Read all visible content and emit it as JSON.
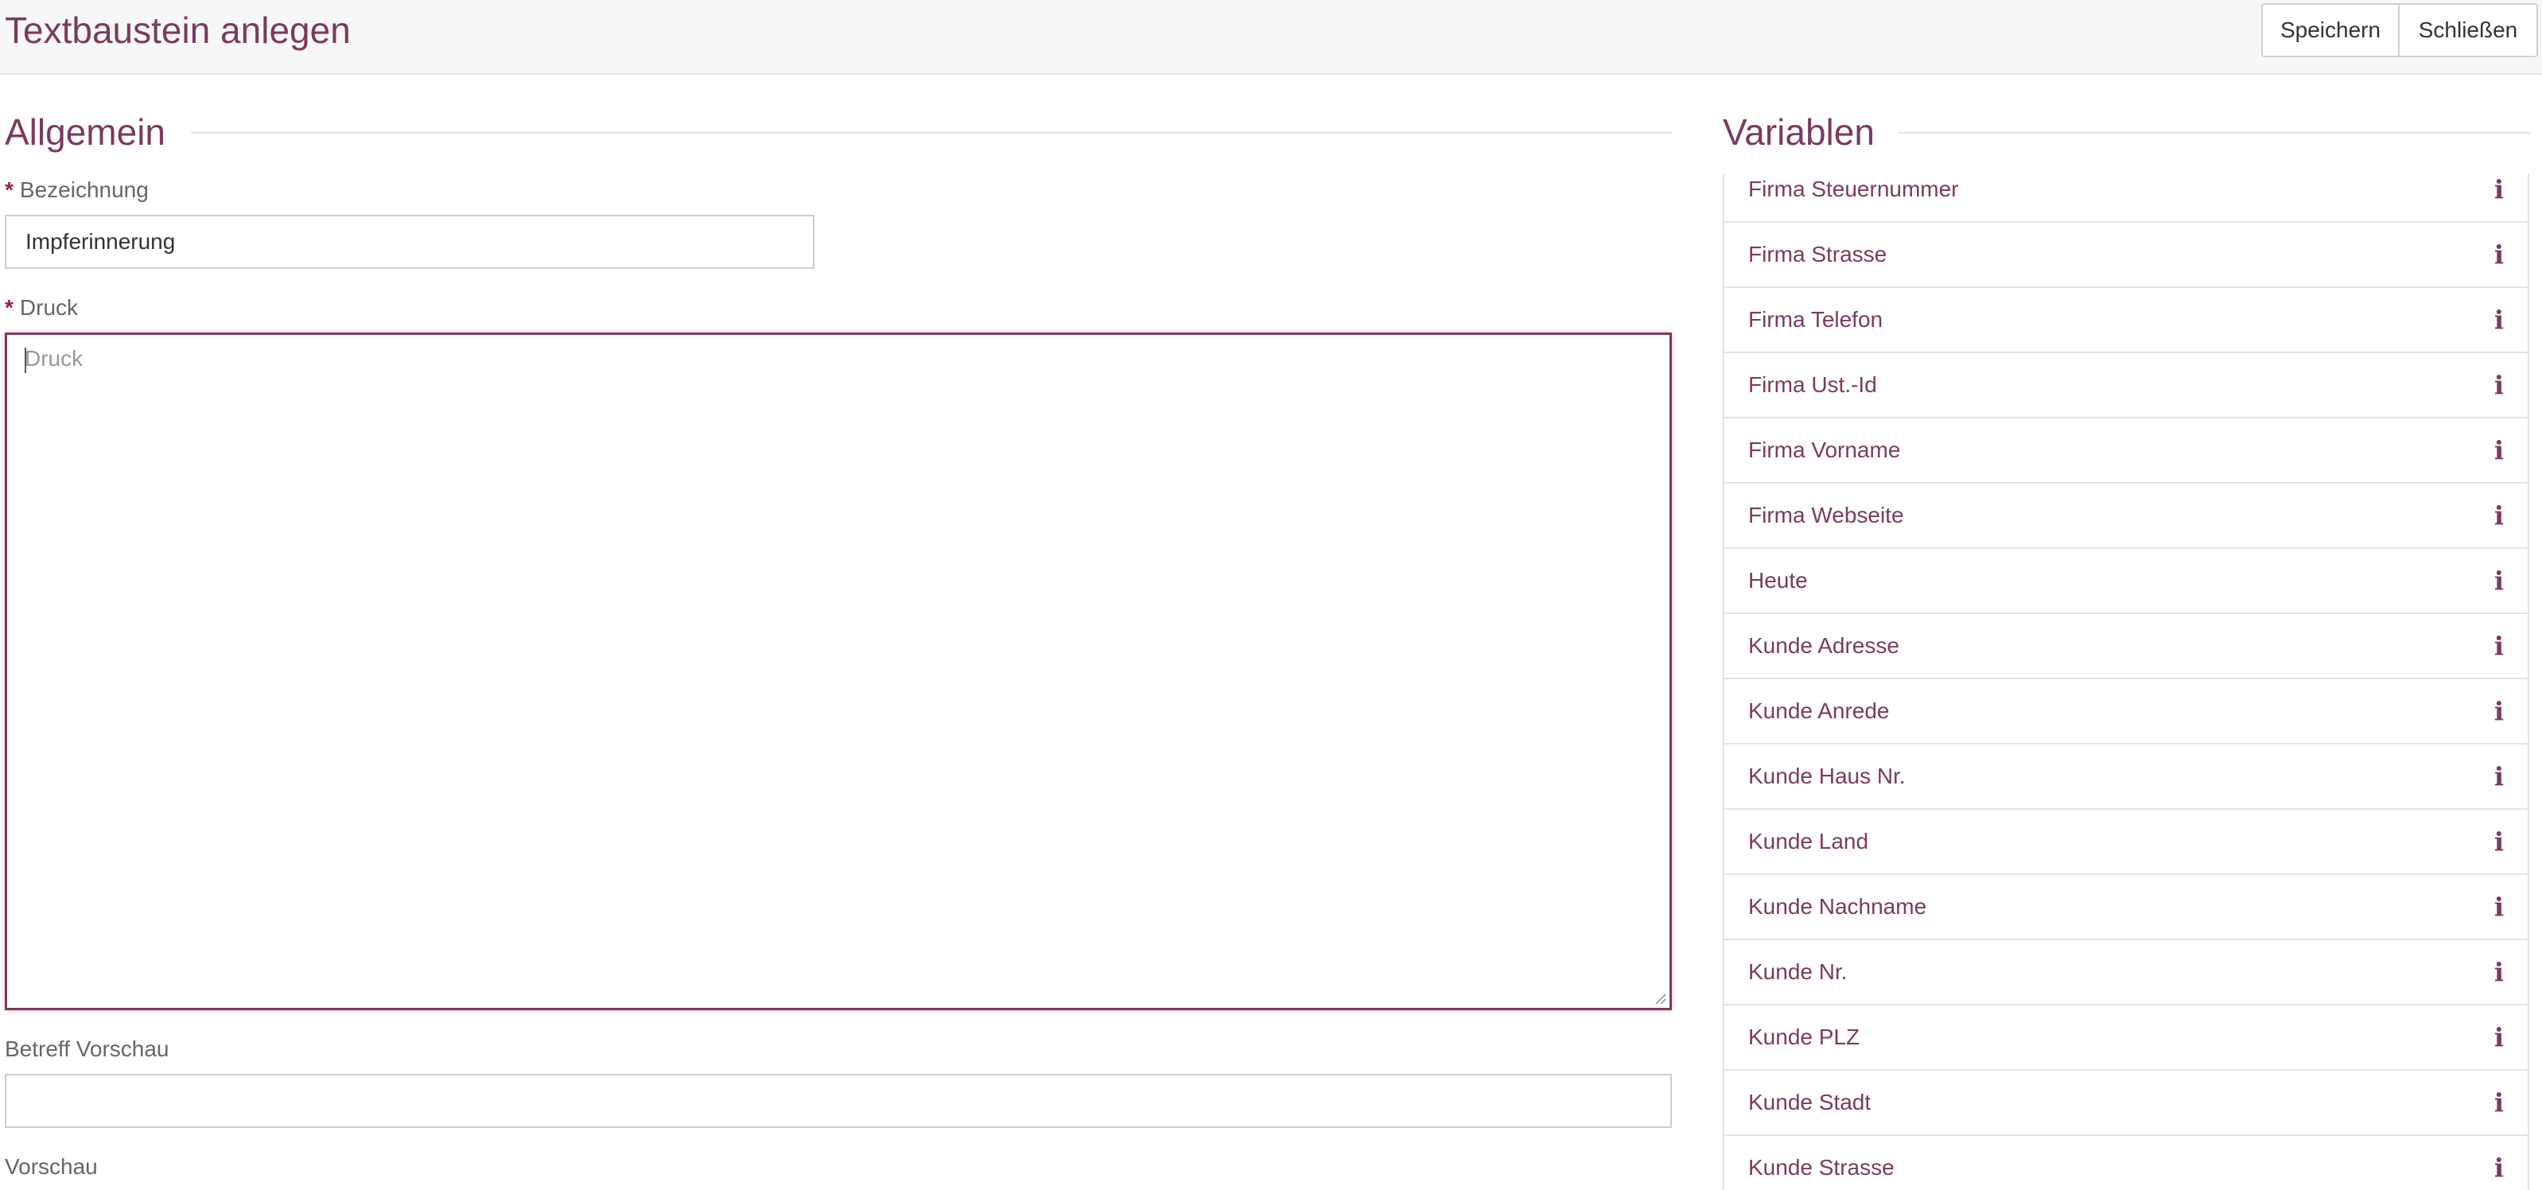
{
  "header": {
    "title": "Textbaustein anlegen",
    "save_label": "Speichern",
    "close_label": "Schließen"
  },
  "general": {
    "title": "Allgemein",
    "name_label": "Bezeichnung",
    "name_value": "Impferinnerung",
    "print_label": "Druck",
    "print_placeholder": "Druck",
    "subject_preview_label": "Betreff Vorschau",
    "subject_preview_value": "",
    "preview_label": "Vorschau",
    "required_marker": "*"
  },
  "variables": {
    "title": "Variablen",
    "items": [
      {
        "label": "Firma Steuernummer"
      },
      {
        "label": "Firma Strasse"
      },
      {
        "label": "Firma Telefon"
      },
      {
        "label": "Firma Ust.-Id"
      },
      {
        "label": "Firma Vorname"
      },
      {
        "label": "Firma Webseite"
      },
      {
        "label": "Heute"
      },
      {
        "label": "Kunde Adresse"
      },
      {
        "label": "Kunde Anrede"
      },
      {
        "label": "Kunde Haus Nr."
      },
      {
        "label": "Kunde Land"
      },
      {
        "label": "Kunde Nachname"
      },
      {
        "label": "Kunde Nr."
      },
      {
        "label": "Kunde PLZ"
      },
      {
        "label": "Kunde Stadt"
      },
      {
        "label": "Kunde Strasse"
      }
    ],
    "info_icon": "i"
  },
  "colors": {
    "accent": "#7a3b5f",
    "required": "#a0213a"
  }
}
